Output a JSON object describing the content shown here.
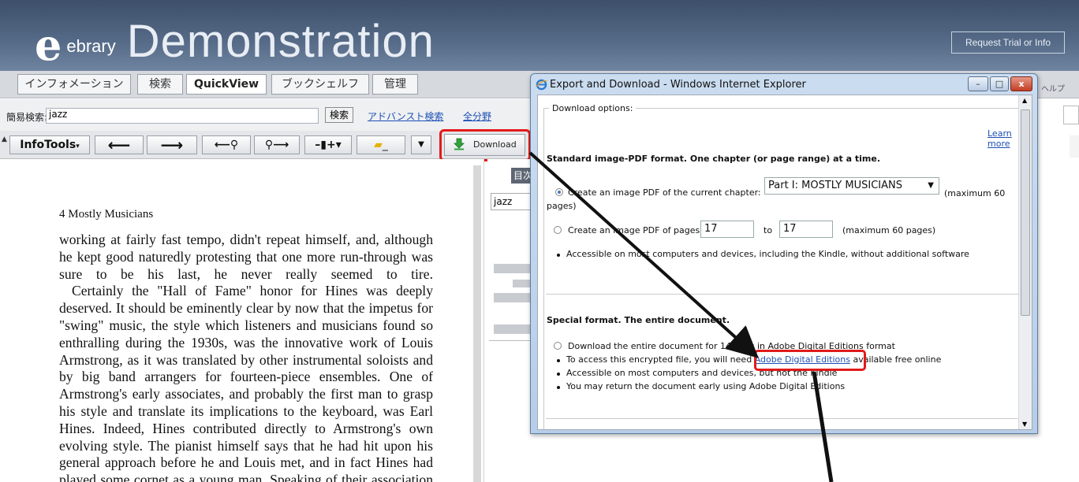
{
  "header": {
    "logo_mark": "e",
    "logo_small": "ebrary",
    "logo_big": "Demonstration",
    "trial_button": "Request Trial or Info"
  },
  "tabs": [
    {
      "label": "インフォメーション"
    },
    {
      "label": "検索"
    },
    {
      "label": "QuickView"
    },
    {
      "label": "ブックシェルフ"
    },
    {
      "label": "管理"
    }
  ],
  "search": {
    "label": "簡易検索:",
    "value": "jazz",
    "button": "検索",
    "advanced_link": "アドバンスト検索",
    "all_link": "全分野"
  },
  "toolbar": {
    "infotools": "InfoTools",
    "download": "Download"
  },
  "document": {
    "chapter_header": "4 Mostly Musicians",
    "paragraphs": [
      "working at fairly fast tempo, didn't repeat himself, and, although he kept good naturedly protesting that one more run-through was sure to be his last, he never really seemed to tire.",
      "Certainly the \"Hall of Fame\" honor for Hines was deeply deserved. It should be eminently clear by now that the impetus for \"swing\" music, the style which listeners and musicians found so enthralling during the 1930s, was the innovative work of Louis Armstrong, as it was translated by other instrumental soloists and by big band arrangers for fourteen-piece ensembles. One of Armstrong's early associates, and probably the first man to grasp his style and translate its implications to the keyboard, was Earl Hines. Indeed, Hines contributed directly to Armstrong's own evolving style. The pianist himself says that he had hit upon his general approach before he and Louis met, and in fact Hines had played some cornet as a young man. Speaking of their association"
    ]
  },
  "right_panel": {
    "contents_tab": "目次",
    "search_value": "jazz",
    "edge_fragment": "ヘルプ"
  },
  "dialog": {
    "title": "Export and Download - Windows Internet Explorer",
    "window_buttons": {
      "minimize": "–",
      "maximize": "□",
      "close": "x"
    },
    "legend": "Download options:",
    "learn_more": "Learn more",
    "standard_heading": "Standard image-PDF format. One chapter (or page range) at a time.",
    "opt1_text": "Create an image PDF of the current chapter:",
    "chapter_select": "Part I: MOSTLY MUSICIANS",
    "opt1_suffix": "(maximum 60",
    "opt1_suffix2": "pages)",
    "opt2_text": "Create an image PDF of pages",
    "page_from": "17",
    "to_label": "to",
    "page_to": "17",
    "opt2_suffix": "(maximum 60 pages)",
    "std_bullet": "Accessible on most computers and devices, including the Kindle, without additional software",
    "special_heading": "Special format. The entire document.",
    "opt3_text": "Download the entire document for 14 days in Adobe Digital Editions format",
    "bullet1_pre": "To access this encrypted file, you will need",
    "bullet1_link": "Adobe Digital Editions",
    "bullet1_post": "available free online",
    "bullet2": "Accessible on most computers and devices, but not the Kindle",
    "bullet3": "You may return the document early using Adobe Digital Editions"
  },
  "colors": {
    "header_blue": "#566b88",
    "annotation_red": "#e21a1a",
    "link_blue": "#1d4fb5"
  }
}
